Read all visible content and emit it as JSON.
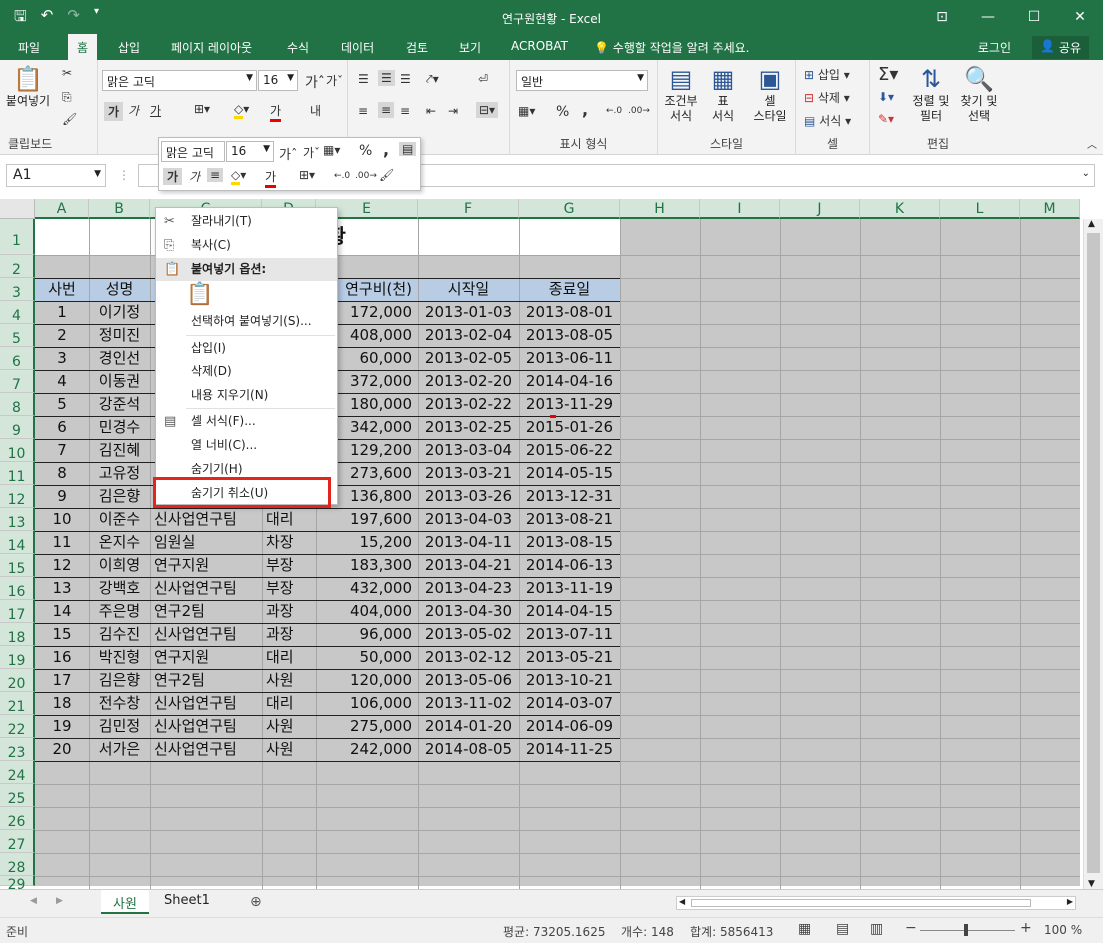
{
  "window": {
    "title": "연구원현황 - Excel"
  },
  "tabs": [
    "파일",
    "홈",
    "삽입",
    "페이지 레이아웃",
    "수식",
    "데이터",
    "검토",
    "보기",
    "ACROBAT"
  ],
  "tell_me": "수행할 작업을 알려 주세요.",
  "login": "로그인",
  "share": "공유",
  "ribbon": {
    "clipboard": {
      "paste": "붙여넣기",
      "label": "클립보드"
    },
    "font": {
      "name": "맑은 고딕",
      "size": "16",
      "bold": "가",
      "italic": "가",
      "underline": "가",
      "fontcolor": "가"
    },
    "align": {
      "wrap": "내",
      "label_tail": "춤"
    },
    "number": {
      "format": "일반",
      "percent": "%",
      "comma": ",",
      "label": "표시 형식"
    },
    "styles": {
      "cond": "조건부\n서식",
      "table": "표\n서식",
      "cell": "셀\n스타일",
      "label": "스타일"
    },
    "cells": {
      "insert": "삽입",
      "delete": "삭제",
      "format": "서식",
      "label": "셀"
    },
    "editing": {
      "sort": "정렬 및\n필터",
      "find": "찾기 및\n선택",
      "label": "편집"
    }
  },
  "namebox": "A1",
  "columns": [
    "A",
    "B",
    "C",
    "D",
    "E",
    "F",
    "G",
    "H",
    "I",
    "J",
    "K",
    "L",
    "M"
  ],
  "rows": [
    "1",
    "2",
    "3",
    "4",
    "5",
    "6",
    "7",
    "8",
    "9",
    "10",
    "11",
    "12",
    "13",
    "14",
    "15",
    "16",
    "17",
    "18",
    "19",
    "20",
    "21",
    "22",
    "23",
    "24",
    "25",
    "26",
    "27",
    "28",
    "29"
  ],
  "sheet": {
    "title": "현황",
    "headers": [
      "사번",
      "성명",
      "",
      "",
      "연구비(천)",
      "시작일",
      "종료일"
    ],
    "data": [
      [
        "1",
        "이기정",
        "",
        "",
        "172,000",
        "2013-01-03",
        "2013-08-01"
      ],
      [
        "2",
        "정미진",
        "",
        "",
        "408,000",
        "2013-02-04",
        "2013-08-05"
      ],
      [
        "3",
        "경인선",
        "",
        "",
        "60,000",
        "2013-02-05",
        "2013-06-11"
      ],
      [
        "4",
        "이동권",
        "",
        "",
        "372,000",
        "2013-02-20",
        "2014-04-16"
      ],
      [
        "5",
        "강준석",
        "",
        "",
        "180,000",
        "2013-02-22",
        "2013-11-29"
      ],
      [
        "6",
        "민경수",
        "",
        "",
        "342,000",
        "2013-02-25",
        "2015-01-26"
      ],
      [
        "7",
        "김진혜",
        "",
        "",
        "129,200",
        "2013-03-04",
        "2015-06-22"
      ],
      [
        "8",
        "고유정",
        "",
        "",
        "273,600",
        "2013-03-21",
        "2014-05-15"
      ],
      [
        "9",
        "김은향",
        "",
        "",
        "136,800",
        "2013-03-26",
        "2013-12-31"
      ],
      [
        "10",
        "이준수",
        "신사업연구팀",
        "대리",
        "197,600",
        "2013-04-03",
        "2013-08-21"
      ],
      [
        "11",
        "온지수",
        "임원실",
        "차장",
        "15,200",
        "2013-04-11",
        "2013-08-15"
      ],
      [
        "12",
        "이희영",
        "연구지원",
        "부장",
        "183,300",
        "2013-04-21",
        "2014-06-13"
      ],
      [
        "13",
        "강백호",
        "신사업연구팀",
        "부장",
        "432,000",
        "2013-04-23",
        "2013-11-19"
      ],
      [
        "14",
        "주은명",
        "연구2팀",
        "과장",
        "404,000",
        "2013-04-30",
        "2014-04-15"
      ],
      [
        "15",
        "김수진",
        "신사업연구팀",
        "과장",
        "96,000",
        "2013-05-02",
        "2013-07-11"
      ],
      [
        "16",
        "박진형",
        "연구지원",
        "대리",
        "50,000",
        "2013-02-12",
        "2013-05-21"
      ],
      [
        "17",
        "김은향",
        "연구2팀",
        "사원",
        "120,000",
        "2013-05-06",
        "2013-10-21"
      ],
      [
        "18",
        "전수창",
        "신사업연구팀",
        "대리",
        "106,000",
        "2013-11-02",
        "2014-03-07"
      ],
      [
        "19",
        "김민정",
        "신사업연구팀",
        "사원",
        "275,000",
        "2014-01-20",
        "2014-06-09"
      ],
      [
        "20",
        "서가은",
        "신사업연구팀",
        "사원",
        "242,000",
        "2014-08-05",
        "2014-11-25"
      ]
    ]
  },
  "context_menu": {
    "cut": "잘라내기(T)",
    "copy": "복사(C)",
    "paste_options": "붙여넣기 옵션:",
    "paste_special": "선택하여 붙여넣기(S)...",
    "insert": "삽입(I)",
    "delete": "삭제(D)",
    "clear": "내용 지우기(N)",
    "format_cells": "셀 서식(F)...",
    "col_width": "열 너비(C)...",
    "hide": "숨기기(H)",
    "unhide": "숨기기 취소(U)"
  },
  "mini_toolbar": {
    "font": "맑은 고딕",
    "size": "16"
  },
  "sheet_tabs": [
    "사원",
    "Sheet1"
  ],
  "status": {
    "ready": "준비",
    "avg": "평균: 73205.1625",
    "count": "개수: 148",
    "sum": "합계: 5856413",
    "zoom": "100 %"
  },
  "colors": {
    "excel_green": "#217346",
    "header_fill": "#b8cce4",
    "grid_gray": "#c0c0c0",
    "highlight": "#e2251d"
  }
}
